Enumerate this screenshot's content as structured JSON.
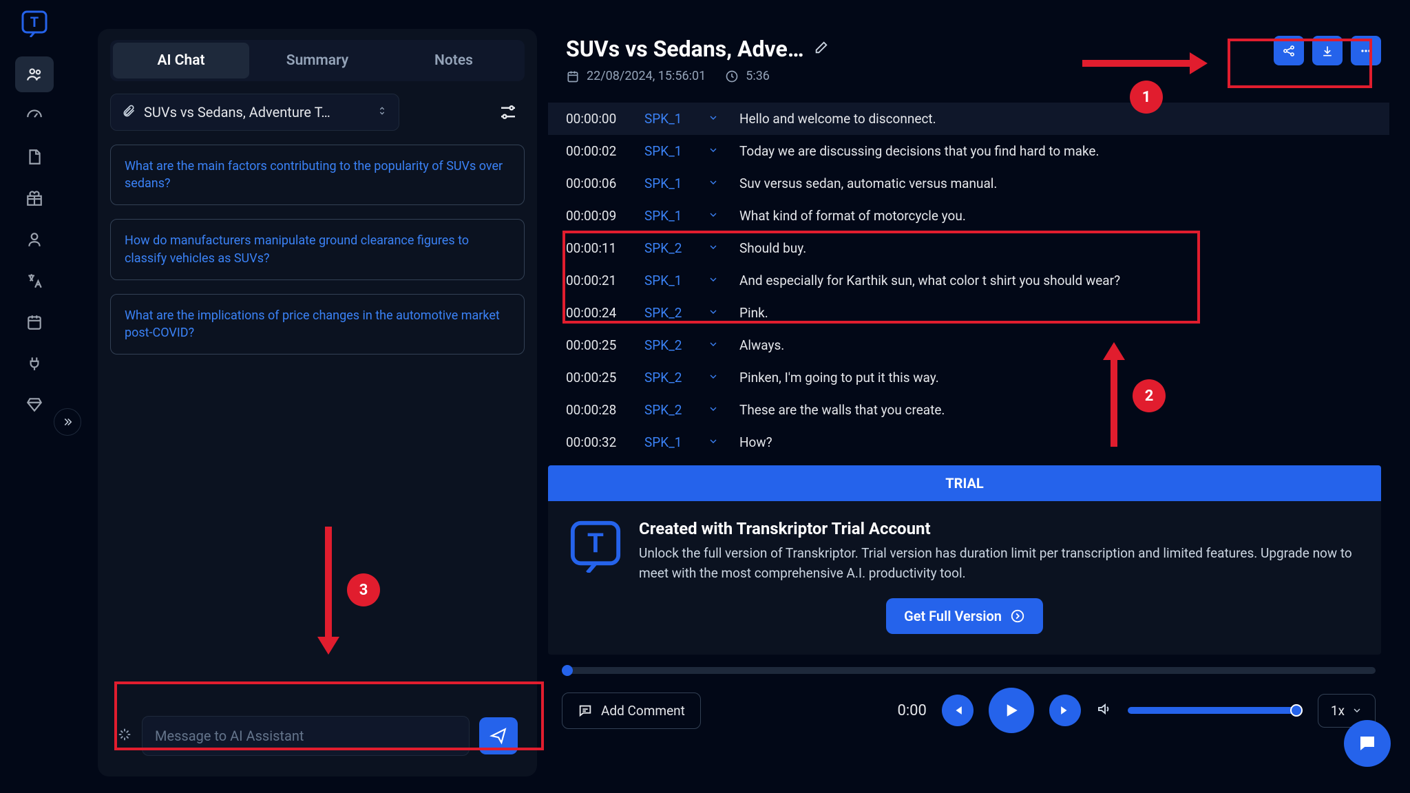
{
  "sidebar": {
    "items": [
      "people",
      "gauge",
      "document",
      "gift",
      "person",
      "translate",
      "calendar",
      "plug",
      "diamond"
    ]
  },
  "left": {
    "tabs": [
      "AI Chat",
      "Summary",
      "Notes"
    ],
    "active_tab": 0,
    "file_selector": "SUVs vs Sedans, Adventure T…",
    "suggestions": [
      "What are the main factors contributing to the popularity of SUVs over sedans?",
      "How do manufacturers manipulate ground clearance figures to classify vehicles as SUVs?",
      "What are the implications of price changes in the automotive market post-COVID?"
    ],
    "compose_placeholder": "Message to AI Assistant"
  },
  "header": {
    "title": "SUVs vs Sedans, Adve…",
    "date": "22/08/2024, 15:56:01",
    "duration": "5:36"
  },
  "transcript": [
    {
      "time": "00:00:00",
      "speaker": "SPK_1",
      "text": "Hello and welcome to disconnect.",
      "hover": true
    },
    {
      "time": "00:00:02",
      "speaker": "SPK_1",
      "text": "Today we are discussing decisions that you find hard to make."
    },
    {
      "time": "00:00:06",
      "speaker": "SPK_1",
      "text": "Suv versus sedan, automatic versus manual."
    },
    {
      "time": "00:00:09",
      "speaker": "SPK_1",
      "text": "What kind of format of motorcycle you."
    },
    {
      "time": "00:00:11",
      "speaker": "SPK_2",
      "text": "Should buy."
    },
    {
      "time": "00:00:21",
      "speaker": "SPK_1",
      "text": "And especially for Karthik sun, what color t shirt you should wear?"
    },
    {
      "time": "00:00:24",
      "speaker": "SPK_2",
      "text": "Pink."
    },
    {
      "time": "00:00:25",
      "speaker": "SPK_2",
      "text": "Always."
    },
    {
      "time": "00:00:25",
      "speaker": "SPK_2",
      "text": "Pinken, I'm going to put it this way."
    },
    {
      "time": "00:00:28",
      "speaker": "SPK_2",
      "text": "These are the walls that you create."
    },
    {
      "time": "00:00:32",
      "speaker": "SPK_1",
      "text": "How?"
    }
  ],
  "trial": {
    "pill": "TRIAL",
    "heading": "Created with Transkriptor Trial Account",
    "body": "Unlock the full version of Transkriptor. Trial version has duration limit per transcription and limited features. Upgrade now to meet with the most comprehensive A.I. productivity tool.",
    "cta": "Get Full Version"
  },
  "player": {
    "add_comment": "Add Comment",
    "current_time": "0:00",
    "speed": "1x"
  },
  "annotations": {
    "labels": [
      "1",
      "2",
      "3"
    ]
  }
}
